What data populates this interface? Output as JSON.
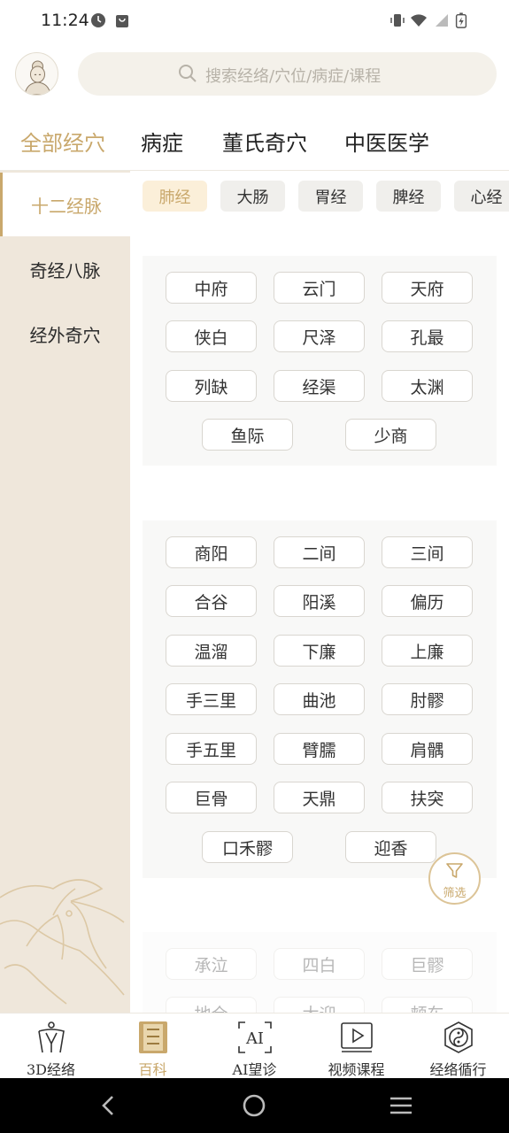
{
  "status": {
    "time": "11:24"
  },
  "search": {
    "placeholder": "搜索经络/穴位/病症/课程"
  },
  "top_tabs": [
    {
      "label": "全部经穴",
      "active": true
    },
    {
      "label": "病症"
    },
    {
      "label": "董氏奇穴"
    },
    {
      "label": "中医医学"
    }
  ],
  "sidebar": {
    "items": [
      {
        "label": "十二经脉",
        "active": true
      },
      {
        "label": "奇经八脉"
      },
      {
        "label": "经外奇穴"
      }
    ]
  },
  "chips": [
    {
      "label": "肺经",
      "active": true
    },
    {
      "label": "大肠"
    },
    {
      "label": "胃经"
    },
    {
      "label": "脾经"
    },
    {
      "label": "心经"
    }
  ],
  "groups": [
    {
      "points": [
        "中府",
        "云门",
        "天府",
        "侠白",
        "尺泽",
        "孔最",
        "列缺",
        "经渠",
        "太渊",
        "鱼际",
        "少商"
      ]
    },
    {
      "points": [
        "商阳",
        "二间",
        "三间",
        "合谷",
        "阳溪",
        "偏历",
        "温溜",
        "下廉",
        "上廉",
        "手三里",
        "曲池",
        "肘髎",
        "手五里",
        "臂臑",
        "肩髃",
        "巨骨",
        "天鼎",
        "扶突",
        "口禾髎",
        "迎香"
      ]
    },
    {
      "points": [
        "承泣",
        "四白",
        "巨髎",
        "地仓",
        "大迎",
        "颊车"
      ]
    }
  ],
  "filter": {
    "label": "筛选"
  },
  "bottom_nav": [
    {
      "label": "3D经络",
      "icon": "body-meridian-icon"
    },
    {
      "label": "百科",
      "icon": "book-icon",
      "active": true
    },
    {
      "label": "AI望诊",
      "icon": "ai-scan-icon"
    },
    {
      "label": "视频课程",
      "icon": "video-icon"
    },
    {
      "label": "经络循行",
      "icon": "yin-yang-icon"
    }
  ],
  "colors": {
    "accent": "#c9a86c",
    "sidebar_bg": "#efe7db",
    "chip_active_bg": "#fbefd9"
  }
}
